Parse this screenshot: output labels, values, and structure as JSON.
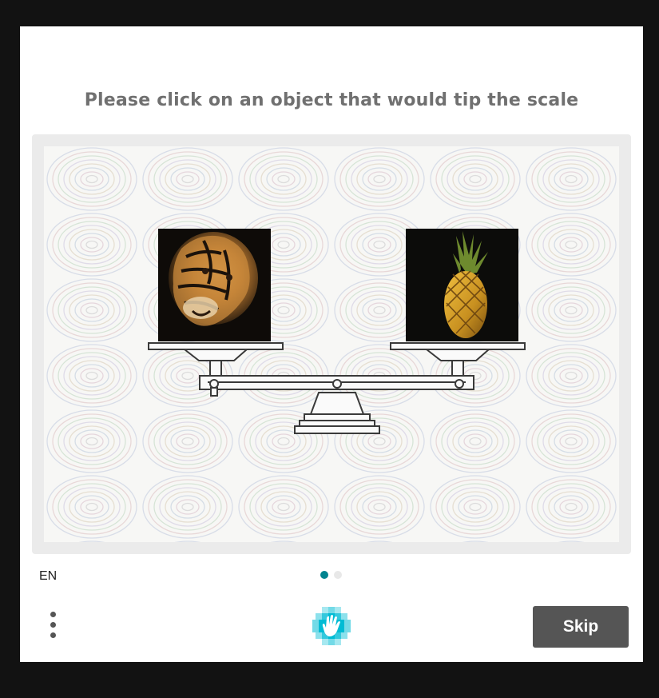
{
  "prompt": {
    "text": "Please click on an object that would tip the scale"
  },
  "challenge": {
    "left_object": "tiger",
    "right_object": "pineapple",
    "center_object": "balance-scale"
  },
  "footer": {
    "language": "EN",
    "page_indicator": {
      "total": 2,
      "current": 1
    },
    "skip_label": "Skip",
    "menu_icon": "more-vertical-icon",
    "logo_icon": "hcaptcha-logo-icon"
  },
  "colors": {
    "page_background": "#121212",
    "card_background": "#ffffff",
    "prompt_text": "#707070",
    "frame_background": "#ebebeb",
    "dot_active": "#00838f",
    "dot_inactive": "#e8e8e8",
    "skip_button": "#555555",
    "logo_teal": "#00bcd4"
  }
}
